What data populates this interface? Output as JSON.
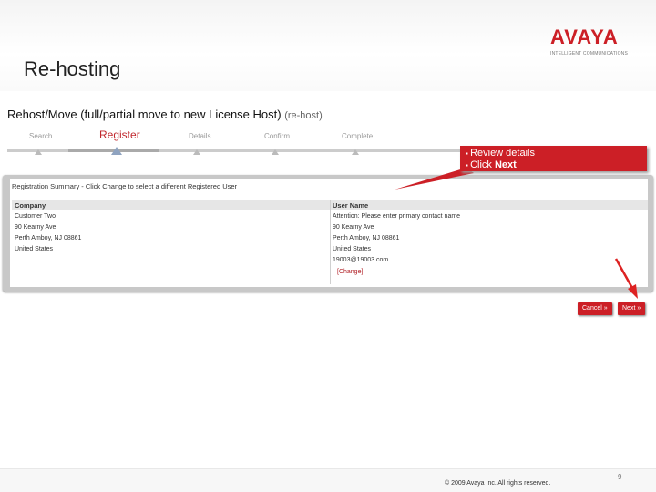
{
  "slide": {
    "title": "Re-hosting"
  },
  "logo": {
    "word": "AVAYA",
    "tagline": "INTELLIGENT COMMUNICATIONS"
  },
  "page": {
    "heading": "Rehost/Move (full/partial move to new License Host)",
    "heading_sub": "(re-host)",
    "steps": [
      {
        "label": "Search"
      },
      {
        "label": "Register",
        "active": true
      },
      {
        "label": "Details"
      },
      {
        "label": "Confirm"
      },
      {
        "label": "Complete"
      }
    ]
  },
  "callout": {
    "items": [
      "Review details",
      "Click"
    ],
    "bold_word": "Next"
  },
  "registration": {
    "summary": "Registration Summary - Click Change to select a different Registered User",
    "company_header": "Company",
    "user_header": "User Name",
    "company_lines": [
      "Customer Two",
      "90 Kearny Ave",
      "Perth Amboy, NJ 08861",
      "United States"
    ],
    "user_lines": [
      "Attention: Please enter primary contact name",
      "90 Kearny Ave",
      "Perth Amboy, NJ 08861",
      "United States",
      "19003@19003.com"
    ],
    "change_label": "[Change]"
  },
  "buttons": {
    "cancel": "Cancel »",
    "next": "Next »"
  },
  "footer": {
    "copyright": "© 2009 Avaya Inc. All rights reserved.",
    "page_number": "9"
  },
  "colors": {
    "accent": "#cc1f26",
    "panel": "#c8c8c8"
  }
}
